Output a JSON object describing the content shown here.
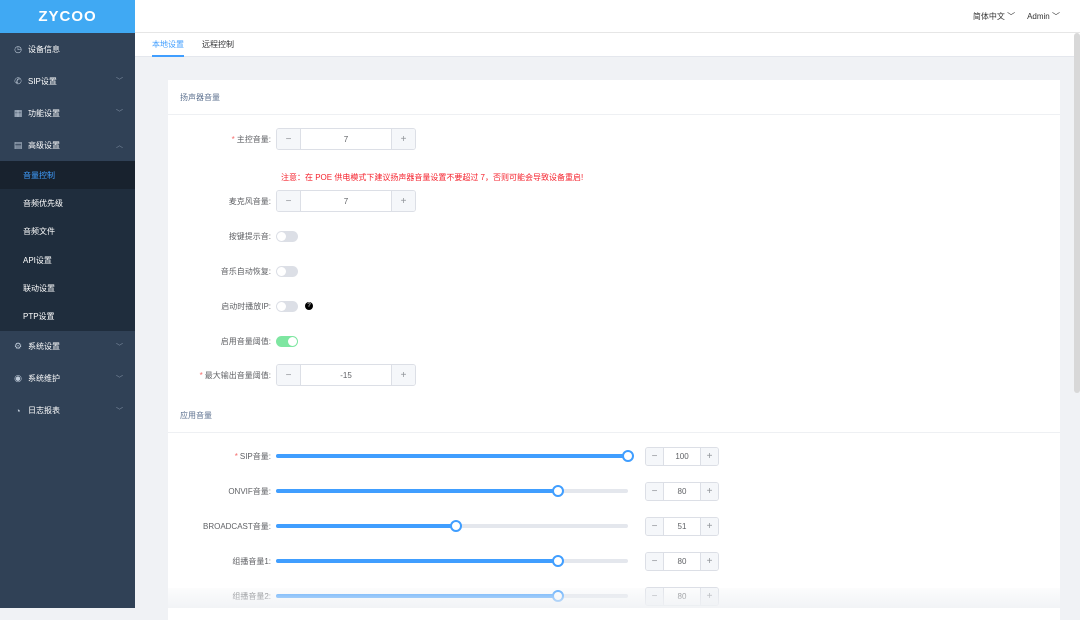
{
  "logo": "ZYCOO",
  "header": {
    "language": "简体中文",
    "user": "Admin"
  },
  "sidebar": {
    "items": [
      {
        "label": "设备信息",
        "icon": "gauge-icon"
      },
      {
        "label": "SIP设置",
        "icon": "phone-icon"
      },
      {
        "label": "功能设置",
        "icon": "grid-icon"
      },
      {
        "label": "高级设置",
        "icon": "document-icon"
      }
    ],
    "sub": [
      "音量控制",
      "音频优先级",
      "音频文件",
      "API设置",
      "联动设置",
      "PTP设置"
    ],
    "items2": [
      {
        "label": "系统设置",
        "icon": "gear-icon"
      },
      {
        "label": "系统维护",
        "icon": "maintenance-icon"
      },
      {
        "label": "日志报表",
        "icon": "clock-icon"
      }
    ]
  },
  "tabs": [
    "本地设置",
    "远程控制"
  ],
  "speaker": {
    "title": "扬声器音量",
    "master_label": "主控音量:",
    "master": "7",
    "warning": "注意：在 POE 供电模式下建议扬声器音量设置不要超过 7，否则可能会导致设备重启!",
    "mic_label": "麦克风音量:",
    "mic": "7",
    "key_tone_label": "按键提示音:",
    "key_tone": false,
    "music_resume_label": "音乐自动恢复:",
    "music_resume": false,
    "boot_ip_label": "启动时播放IP:",
    "boot_ip": false,
    "threshold_enable_label": "启用音量阈值:",
    "threshold_enable": true,
    "max_out_label": "最大输出音量阈值:",
    "max_out": "-15"
  },
  "app": {
    "title": "应用音量",
    "sliders": [
      {
        "label": "SIP音量:",
        "value": 100,
        "required": true
      },
      {
        "label": "ONVIF音量:",
        "value": 80
      },
      {
        "label": "BROADCAST音量:",
        "value": 51
      },
      {
        "label": "组播音量1:",
        "value": 80
      },
      {
        "label": "组播音量2:",
        "value": 80
      }
    ]
  }
}
